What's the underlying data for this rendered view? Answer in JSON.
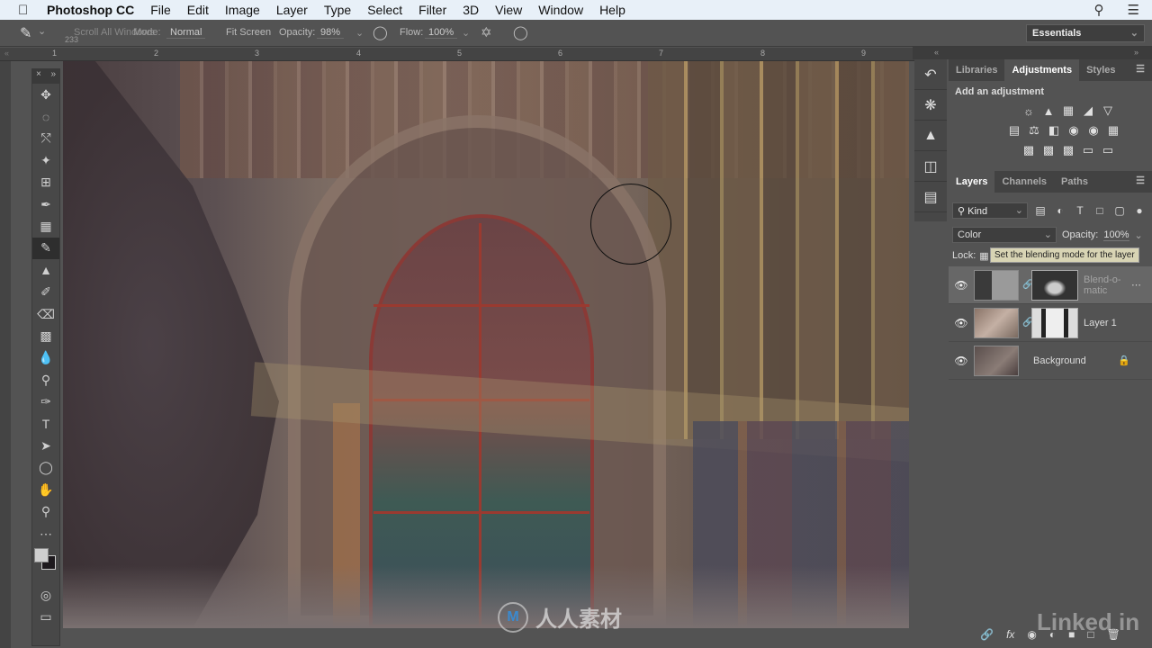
{
  "menubar": {
    "app_name": "Photoshop CC",
    "items": [
      "File",
      "Edit",
      "Image",
      "Layer",
      "Type",
      "Select",
      "Filter",
      "3D",
      "View",
      "Window",
      "Help"
    ],
    "icons": [
      "apple-icon",
      "search-icon",
      "list-icon"
    ]
  },
  "options_bar": {
    "brush_size": "233",
    "scroll_all_windows": "Scroll All Windows",
    "mode_label": "Mode:",
    "mode_value": "Normal",
    "fit_screen": "Fit Screen",
    "opacity_label": "Opacity:",
    "opacity_value": "98%",
    "flow_label": "Flow:",
    "flow_value": "100%",
    "workspace": "Essentials"
  },
  "ruler": {
    "labels": [
      "1",
      "2",
      "3",
      "4",
      "5",
      "6",
      "7",
      "8",
      "9"
    ]
  },
  "toolbar": {
    "tools": [
      "move",
      "marquee",
      "lasso",
      "quick-select",
      "crop",
      "eyedropper",
      "healing",
      "brush",
      "clone-stamp",
      "history-brush",
      "eraser",
      "gradient",
      "blur",
      "dodge",
      "pen",
      "type",
      "path-select",
      "ellipse",
      "hand",
      "zoom",
      "more"
    ],
    "active_tool": "brush",
    "foreground_color": "#cfcfcf",
    "background_color": "#1e1a1e"
  },
  "panels": {
    "top_tabs": [
      "Libraries",
      "Adjustments",
      "Styles"
    ],
    "active_top_tab": "Adjustments",
    "add_adjustment": "Add an adjustment",
    "adjustment_icons_row1": [
      "brightness-contrast",
      "levels",
      "curves",
      "exposure",
      "vibrance"
    ],
    "adjustment_icons_row2": [
      "hue-saturation",
      "color-balance",
      "black-white",
      "photo-filter",
      "channel-mixer",
      "color-lookup"
    ],
    "adjustment_icons_row3": [
      "invert",
      "posterize",
      "threshold",
      "selective-color",
      "gradient-map"
    ],
    "layer_tabs": [
      "Layers",
      "Channels",
      "Paths"
    ],
    "active_layer_tab": "Layers",
    "filter_kind": "Kind",
    "blend_mode": "Color",
    "opacity_label": "Opacity:",
    "opacity_value": "100%",
    "lock_label": "Lock:",
    "tooltip": "Set the blending mode for the layer",
    "layers": [
      {
        "name": "Blend-o-matic",
        "visible": true,
        "selected": true,
        "type": "adjustment"
      },
      {
        "name": "Layer 1",
        "visible": true,
        "selected": false,
        "type": "smart-object"
      },
      {
        "name": "Background",
        "visible": true,
        "selected": false,
        "type": "background",
        "locked": true
      }
    ]
  },
  "watermarks": {
    "center": "人人素材",
    "corner": "Linked in"
  }
}
